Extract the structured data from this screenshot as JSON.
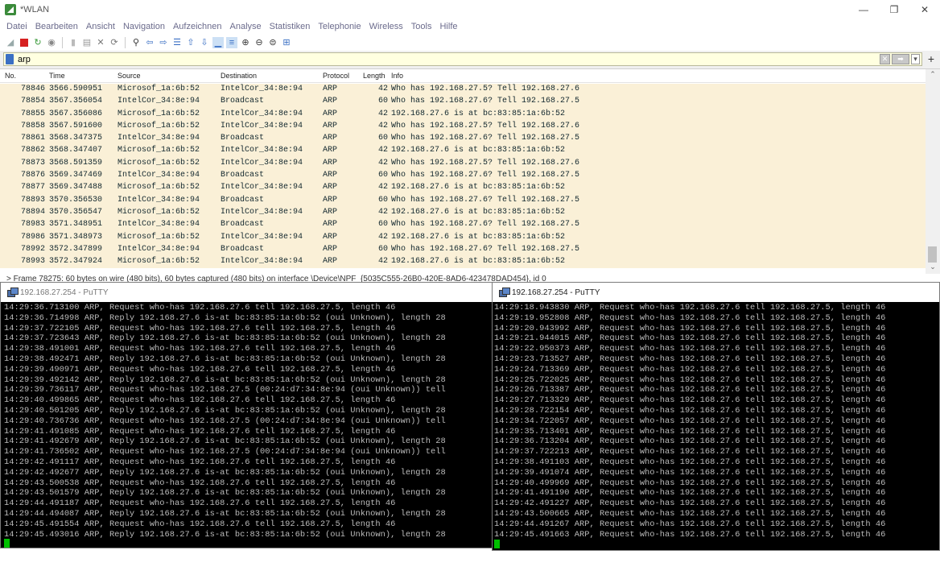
{
  "window": {
    "title": "*WLAN",
    "controls": [
      "—",
      "❐",
      "✕"
    ]
  },
  "menu": [
    "Datei",
    "Bearbeiten",
    "Ansicht",
    "Navigation",
    "Aufzeichnen",
    "Analyse",
    "Statistiken",
    "Telephonie",
    "Wireless",
    "Tools",
    "Hilfe"
  ],
  "toolbar": {
    "icons": [
      "shark-fin-start-icon",
      "stop-capture-icon",
      "restart-capture-icon",
      "capture-options-icon",
      "open-file-icon",
      "save-file-icon",
      "close-file-icon",
      "reload-icon",
      "find-packet-icon",
      "go-back-icon",
      "go-forward-icon",
      "go-to-packet-icon",
      "go-first-icon",
      "go-last-icon",
      "autoscroll-icon",
      "colorize-icon",
      "zoom-in-icon",
      "zoom-out-icon",
      "zoom-normal-icon",
      "resize-columns-icon"
    ]
  },
  "filter": {
    "value": "arp"
  },
  "packet_list": {
    "columns": [
      "No.",
      "Time",
      "Source",
      "Destination",
      "Protocol",
      "Length",
      "Info"
    ],
    "rows": [
      {
        "no": "78846",
        "time": "3566.590951",
        "src": "Microsof_1a:6b:52",
        "dst": "IntelCor_34:8e:94",
        "proto": "ARP",
        "len": "42",
        "info": "Who has 192.168.27.5? Tell 192.168.27.6"
      },
      {
        "no": "78854",
        "time": "3567.356054",
        "src": "IntelCor_34:8e:94",
        "dst": "Broadcast",
        "proto": "ARP",
        "len": "60",
        "info": "Who has 192.168.27.6? Tell 192.168.27.5"
      },
      {
        "no": "78855",
        "time": "3567.356086",
        "src": "Microsof_1a:6b:52",
        "dst": "IntelCor_34:8e:94",
        "proto": "ARP",
        "len": "42",
        "info": "192.168.27.6 is at bc:83:85:1a:6b:52"
      },
      {
        "no": "78858",
        "time": "3567.591600",
        "src": "Microsof_1a:6b:52",
        "dst": "IntelCor_34:8e:94",
        "proto": "ARP",
        "len": "42",
        "info": "Who has 192.168.27.5? Tell 192.168.27.6"
      },
      {
        "no": "78861",
        "time": "3568.347375",
        "src": "IntelCor_34:8e:94",
        "dst": "Broadcast",
        "proto": "ARP",
        "len": "60",
        "info": "Who has 192.168.27.6? Tell 192.168.27.5"
      },
      {
        "no": "78862",
        "time": "3568.347407",
        "src": "Microsof_1a:6b:52",
        "dst": "IntelCor_34:8e:94",
        "proto": "ARP",
        "len": "42",
        "info": "192.168.27.6 is at bc:83:85:1a:6b:52"
      },
      {
        "no": "78873",
        "time": "3568.591359",
        "src": "Microsof_1a:6b:52",
        "dst": "IntelCor_34:8e:94",
        "proto": "ARP",
        "len": "42",
        "info": "Who has 192.168.27.5? Tell 192.168.27.6"
      },
      {
        "no": "78876",
        "time": "3569.347469",
        "src": "IntelCor_34:8e:94",
        "dst": "Broadcast",
        "proto": "ARP",
        "len": "60",
        "info": "Who has 192.168.27.6? Tell 192.168.27.5"
      },
      {
        "no": "78877",
        "time": "3569.347488",
        "src": "Microsof_1a:6b:52",
        "dst": "IntelCor_34:8e:94",
        "proto": "ARP",
        "len": "42",
        "info": "192.168.27.6 is at bc:83:85:1a:6b:52"
      },
      {
        "no": "78893",
        "time": "3570.356530",
        "src": "IntelCor_34:8e:94",
        "dst": "Broadcast",
        "proto": "ARP",
        "len": "60",
        "info": "Who has 192.168.27.6? Tell 192.168.27.5"
      },
      {
        "no": "78894",
        "time": "3570.356547",
        "src": "Microsof_1a:6b:52",
        "dst": "IntelCor_34:8e:94",
        "proto": "ARP",
        "len": "42",
        "info": "192.168.27.6 is at bc:83:85:1a:6b:52"
      },
      {
        "no": "78983",
        "time": "3571.348951",
        "src": "IntelCor_34:8e:94",
        "dst": "Broadcast",
        "proto": "ARP",
        "len": "60",
        "info": "Who has 192.168.27.6? Tell 192.168.27.5"
      },
      {
        "no": "78986",
        "time": "3571.348973",
        "src": "Microsof_1a:6b:52",
        "dst": "IntelCor_34:8e:94",
        "proto": "ARP",
        "len": "42",
        "info": "192.168.27.6 is at bc:83:85:1a:6b:52"
      },
      {
        "no": "78992",
        "time": "3572.347899",
        "src": "IntelCor_34:8e:94",
        "dst": "Broadcast",
        "proto": "ARP",
        "len": "60",
        "info": "Who has 192.168.27.6? Tell 192.168.27.5"
      },
      {
        "no": "78993",
        "time": "3572.347924",
        "src": "Microsof_1a:6b:52",
        "dst": "IntelCor_34:8e:94",
        "proto": "ARP",
        "len": "42",
        "info": "192.168.27.6 is at bc:83:85:1a:6b:52"
      }
    ]
  },
  "detail_strip": "> Frame 78275: 60 bytes on wire (480 bits), 60 bytes captured (480 bits) on interface \\Device\\NPF_{5035C555-26B0-420E-8AD6-423478DAD454}, id 0",
  "putty_left": {
    "title": "192.168.27.254 - PuTTY",
    "lines": [
      "14:29:36.713100 ARP, Request who-has 192.168.27.6 tell 192.168.27.5, length 46",
      "14:29:36.714998 ARP, Reply 192.168.27.6 is-at bc:83:85:1a:6b:52 (oui Unknown), length 28",
      "14:29:37.722105 ARP, Request who-has 192.168.27.6 tell 192.168.27.5, length 46",
      "14:29:37.723643 ARP, Reply 192.168.27.6 is-at bc:83:85:1a:6b:52 (oui Unknown), length 28",
      "14:29:38.491001 ARP, Request who-has 192.168.27.6 tell 192.168.27.5, length 46",
      "14:29:38.492471 ARP, Reply 192.168.27.6 is-at bc:83:85:1a:6b:52 (oui Unknown), length 28",
      "14:29:39.490971 ARP, Request who-has 192.168.27.6 tell 192.168.27.5, length 46",
      "14:29:39.492142 ARP, Reply 192.168.27.6 is-at bc:83:85:1a:6b:52 (oui Unknown), length 28",
      "14:29:39.736117 ARP, Request who-has 192.168.27.5 (00:24:d7:34:8e:94 (oui Unknown)) tell",
      "14:29:40.499865 ARP, Request who-has 192.168.27.6 tell 192.168.27.5, length 46",
      "14:29:40.501205 ARP, Reply 192.168.27.6 is-at bc:83:85:1a:6b:52 (oui Unknown), length 28",
      "14:29:40.736736 ARP, Request who-has 192.168.27.5 (00:24:d7:34:8e:94 (oui Unknown)) tell",
      "14:29:41.491085 ARP, Request who-has 192.168.27.6 tell 192.168.27.5, length 46",
      "14:29:41.492679 ARP, Reply 192.168.27.6 is-at bc:83:85:1a:6b:52 (oui Unknown), length 28",
      "14:29:41.736502 ARP, Request who-has 192.168.27.5 (00:24:d7:34:8e:94 (oui Unknown)) tell",
      "14:29:42.491117 ARP, Request who-has 192.168.27.6 tell 192.168.27.5, length 46",
      "14:29:42.492677 ARP, Reply 192.168.27.6 is-at bc:83:85:1a:6b:52 (oui Unknown), length 28",
      "14:29:43.500538 ARP, Request who-has 192.168.27.6 tell 192.168.27.5, length 46",
      "14:29:43.501579 ARP, Reply 192.168.27.6 is-at bc:83:85:1a:6b:52 (oui Unknown), length 28",
      "14:29:44.491187 ARP, Request who-has 192.168.27.6 tell 192.168.27.5, length 46",
      "14:29:44.494087 ARP, Reply 192.168.27.6 is-at bc:83:85:1a:6b:52 (oui Unknown), length 28",
      "14:29:45.491554 ARP, Request who-has 192.168.27.6 tell 192.168.27.5, length 46",
      "14:29:45.493016 ARP, Reply 192.168.27.6 is-at bc:83:85:1a:6b:52 (oui Unknown), length 28"
    ]
  },
  "putty_right": {
    "title": "192.168.27.254 - PuTTY",
    "lines": [
      "14:29:18.943830 ARP, Request who-has 192.168.27.6 tell 192.168.27.5, length 46",
      "14:29:19.952808 ARP, Request who-has 192.168.27.6 tell 192.168.27.5, length 46",
      "14:29:20.943992 ARP, Request who-has 192.168.27.6 tell 192.168.27.5, length 46",
      "14:29:21.944015 ARP, Request who-has 192.168.27.6 tell 192.168.27.5, length 46",
      "14:29:22.950373 ARP, Request who-has 192.168.27.6 tell 192.168.27.5, length 46",
      "14:29:23.713527 ARP, Request who-has 192.168.27.6 tell 192.168.27.5, length 46",
      "14:29:24.713369 ARP, Request who-has 192.168.27.6 tell 192.168.27.5, length 46",
      "14:29:25.722025 ARP, Request who-has 192.168.27.6 tell 192.168.27.5, length 46",
      "14:29:26.713387 ARP, Request who-has 192.168.27.6 tell 192.168.27.5, length 46",
      "14:29:27.713329 ARP, Request who-has 192.168.27.6 tell 192.168.27.5, length 46",
      "14:29:28.722154 ARP, Request who-has 192.168.27.6 tell 192.168.27.5, length 46",
      "14:29:34.722057 ARP, Request who-has 192.168.27.6 tell 192.168.27.5, length 46",
      "14:29:35.713401 ARP, Request who-has 192.168.27.6 tell 192.168.27.5, length 46",
      "14:29:36.713204 ARP, Request who-has 192.168.27.6 tell 192.168.27.5, length 46",
      "14:29:37.722213 ARP, Request who-has 192.168.27.6 tell 192.168.27.5, length 46",
      "14:29:38.491103 ARP, Request who-has 192.168.27.6 tell 192.168.27.5, length 46",
      "14:29:39.491074 ARP, Request who-has 192.168.27.6 tell 192.168.27.5, length 46",
      "14:29:40.499969 ARP, Request who-has 192.168.27.6 tell 192.168.27.5, length 46",
      "14:29:41.491190 ARP, Request who-has 192.168.27.6 tell 192.168.27.5, length 46",
      "14:29:42.491227 ARP, Request who-has 192.168.27.6 tell 192.168.27.5, length 46",
      "14:29:43.500665 ARP, Request who-has 192.168.27.6 tell 192.168.27.5, length 46",
      "14:29:44.491267 ARP, Request who-has 192.168.27.6 tell 192.168.27.5, length 46",
      "14:29:45.491663 ARP, Request who-has 192.168.27.6 tell 192.168.27.5, length 46"
    ]
  },
  "colors": {
    "row_bg": "#faf0d7",
    "filter_bg": "#ffffe0",
    "terminal_bg": "#000000",
    "terminal_fg": "#bbbbbb",
    "cursor": "#00c000"
  }
}
